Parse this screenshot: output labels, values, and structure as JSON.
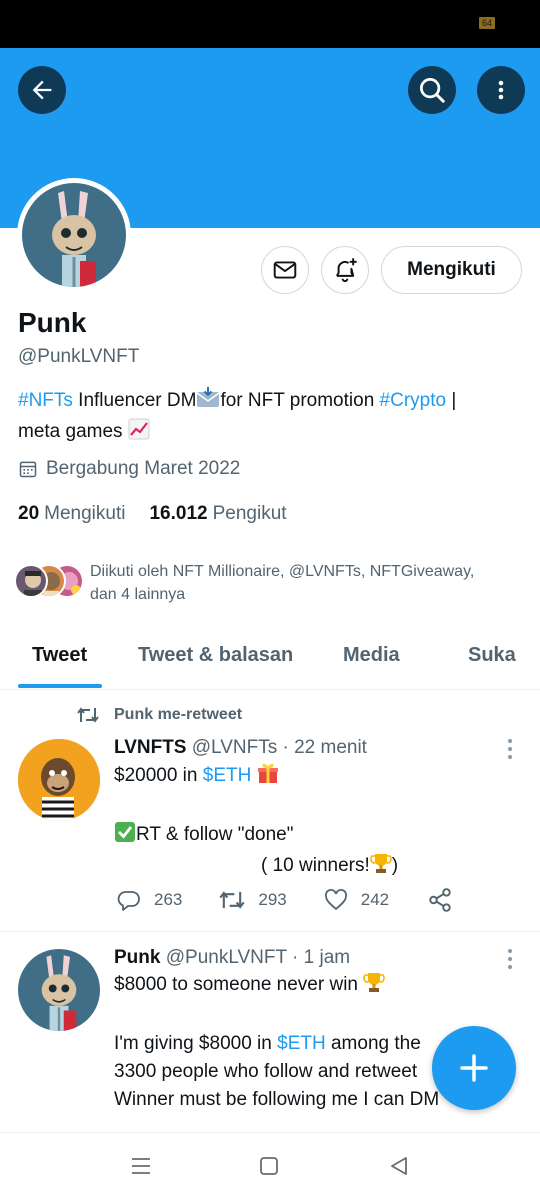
{
  "status_bar": {
    "battery": "64"
  },
  "profile": {
    "display_name": "Punk",
    "handle": "@PunkLVNFT",
    "bio": {
      "hashtag1": "#NFTs",
      "text1": " Influencer DM",
      "text2": "for NFT promotion ",
      "hashtag2": "#Crypto",
      "text3": " |",
      "line2": "meta games "
    },
    "joined": "Bergabung Maret 2022",
    "following_count": "20",
    "following_label": "Mengikuti",
    "followers_count": "16.012",
    "followers_label": "Pengikut",
    "followed_by_line1": "Diikuti oleh NFT Millionaire, @LVNFTs, NFTGiveaway,",
    "followed_by_line2": "dan 4 lainnya",
    "following_button": "Mengikuti"
  },
  "tabs": [
    {
      "label": "Tweet",
      "active": true
    },
    {
      "label": "Tweet & balasan",
      "active": false
    },
    {
      "label": "Media",
      "active": false
    },
    {
      "label": "Suka",
      "active": false
    }
  ],
  "tweets": [
    {
      "retweet_label": "Punk me-retweet",
      "name": "LVNFTS",
      "meta": " @LVNFTs · 22 menit",
      "line1_text": "$20000 in ",
      "line1_link": "$ETH",
      "line3": "RT & follow \"done\"",
      "line4": "( 10 winners!",
      "line4_end": ")",
      "replies": "263",
      "retweets": "293",
      "likes": "242"
    },
    {
      "name": "Punk",
      "meta": " @PunkLVNFT · 1 jam",
      "line1": "$8000 to someone never win ",
      "line3_text": "I'm giving $8000 in ",
      "line3_link": "$ETH",
      "line3_end": " among the",
      "line4": "3300 people who follow and retweet",
      "line5": "Winner must be following me I can DM"
    }
  ],
  "colors": {
    "accent": "#1d9bf0",
    "banner": "#1d9bf0",
    "dark_button": "#0f3a56",
    "text": "#0f1419",
    "secondary": "#536471"
  },
  "icons": [
    "back-arrow-icon",
    "search-icon",
    "more-vertical-icon",
    "mail-icon",
    "bell-plus-icon",
    "calendar-icon",
    "retweet-icon",
    "reply-icon",
    "like-icon",
    "share-icon",
    "compose-plus-icon",
    "menu-icon",
    "home-square-icon",
    "back-triangle-icon"
  ]
}
